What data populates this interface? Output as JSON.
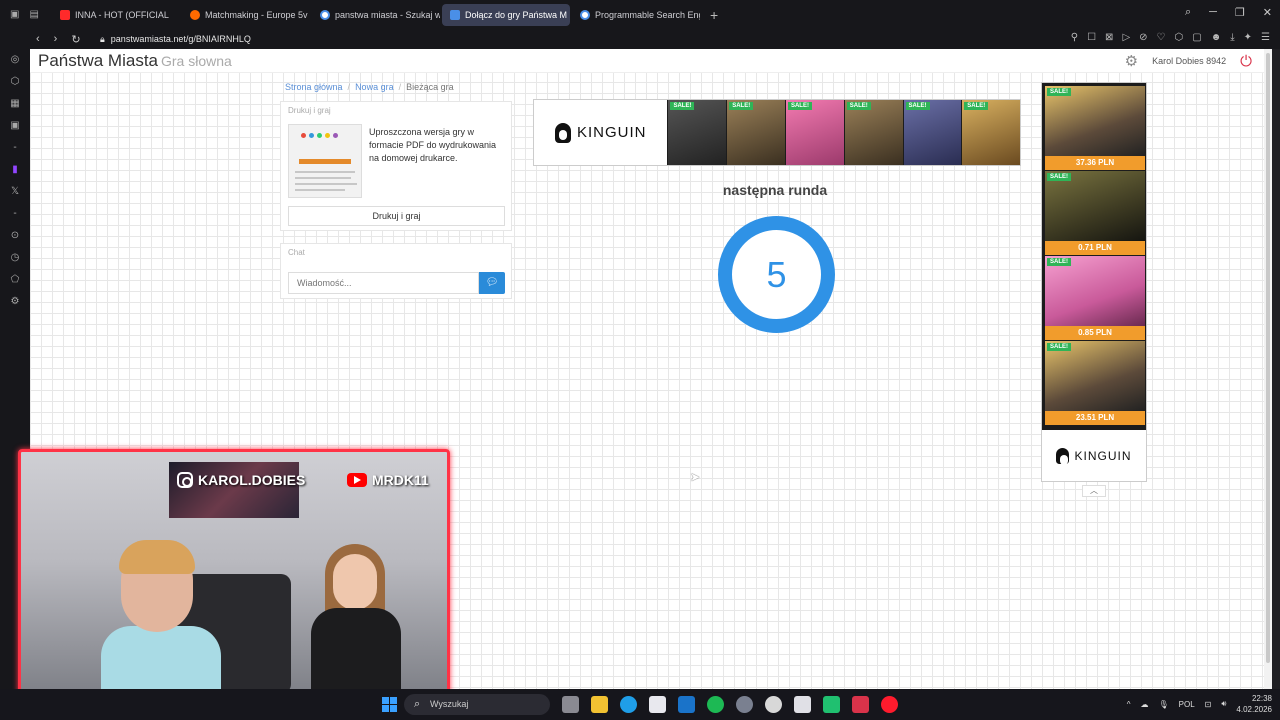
{
  "browser": {
    "tabs": [
      {
        "label": "INNA - HOT (OFFICIAL",
        "color": "#ff2a2a"
      },
      {
        "label": "Matchmaking - Europe 5v",
        "color": "#ff6a00"
      },
      {
        "label": "panstwa miasta - Szukaj w",
        "color": "#ffffff"
      },
      {
        "label": "Dołącz do gry Państwa M",
        "color": "#4a8fe7"
      },
      {
        "label": "Programmable Search Eng",
        "color": "#ffffff"
      }
    ],
    "active_tab": 3,
    "url": "panstwamiasta.net/g/BNIAIRNHLQ"
  },
  "site": {
    "brand": "Państwa Miasta",
    "brand_sub": "Gra słowna",
    "user": "Karol Dobies 8942"
  },
  "breadcrumb": {
    "home": "Strona główna",
    "new_game": "Nowa gra",
    "current": "Bieżąca gra"
  },
  "print_panel": {
    "title": "Drukuj i graj",
    "description": "Uproszczona wersja gry w formacie PDF do wydrukowania na domowej drukarce.",
    "button": "Drukuj i graj"
  },
  "chat": {
    "title": "Chat",
    "placeholder": "Wiadomość..."
  },
  "ad_banner": {
    "brand": "KINGUIN",
    "sale_label": "SALE!",
    "games": [
      "#2a2a2a",
      "#6b5a3a",
      "#d94f8a",
      "#6b5a3a",
      "#3a3f66",
      "#b08a40"
    ]
  },
  "round": {
    "label": "następna runda",
    "countdown": "5"
  },
  "side_ad": {
    "brand": "KINGUIN",
    "sale_label": "SALE!",
    "items": [
      {
        "price": "37.36 PLN",
        "color": "#5c4a3a"
      },
      {
        "price": "0.71 PLN",
        "color": "#3d3a22"
      },
      {
        "price": "0.85 PLN",
        "color": "#c95a9a"
      },
      {
        "price": "23.51 PLN",
        "color": "#5c4a3a"
      }
    ]
  },
  "webcam": {
    "instagram": "KAROL.DOBIES",
    "youtube": "MRDK11"
  },
  "taskbar": {
    "search": "Wyszukaj",
    "lang": "POL",
    "time": "22:38",
    "date": "4.02.2026"
  }
}
